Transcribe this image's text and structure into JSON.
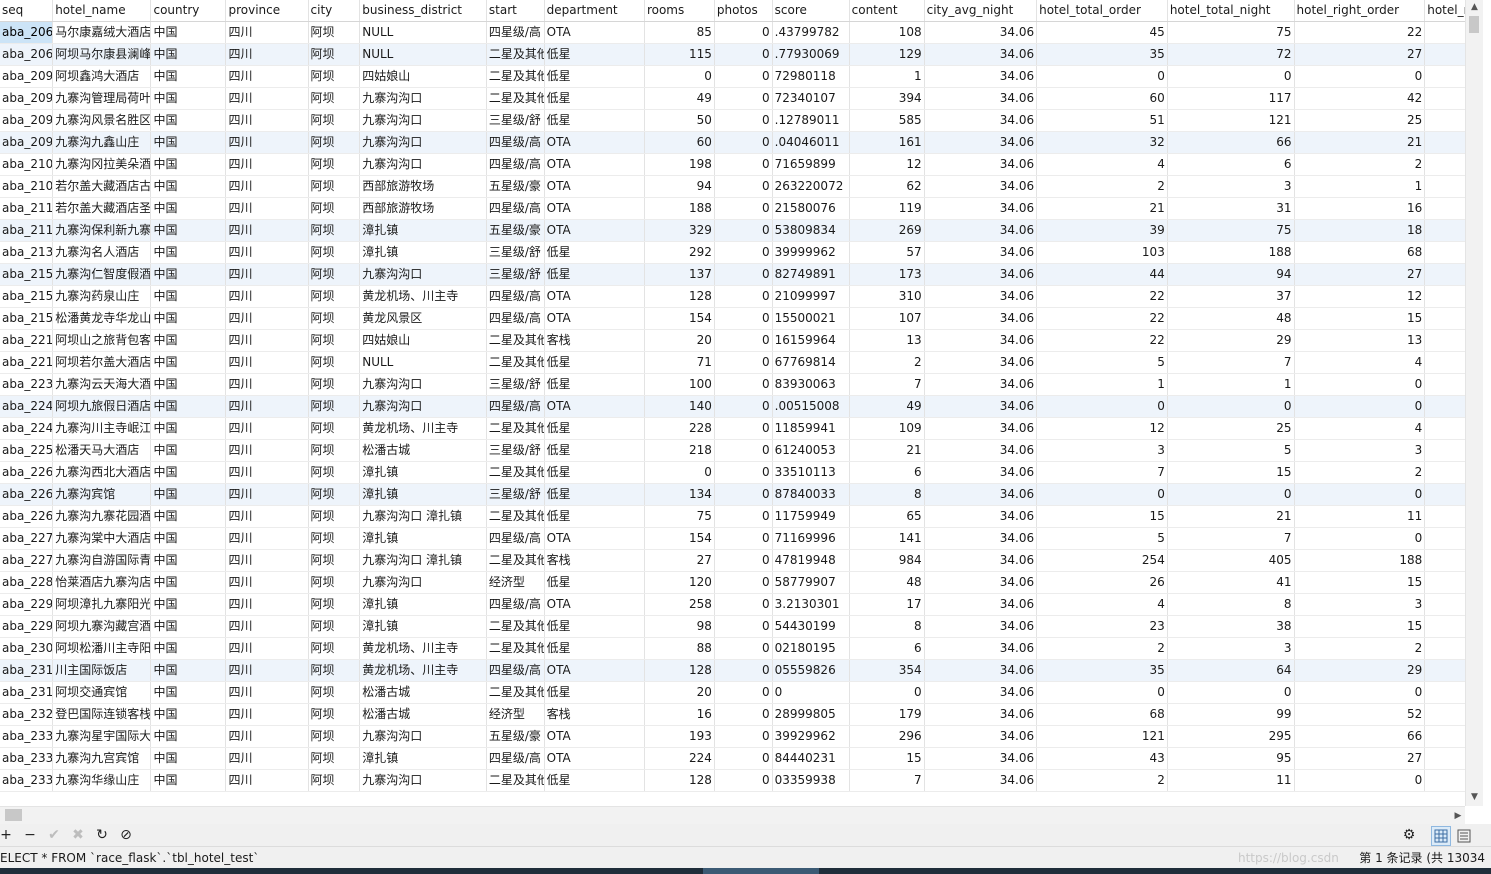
{
  "grid": {
    "columns": [
      "seq",
      "hotel_name",
      "country",
      "province",
      "city",
      "business_district",
      "start",
      "department",
      "rooms",
      "photos",
      "score",
      "content",
      "city_avg_night",
      "hotel_total_order",
      "hotel_total_night",
      "hotel_right_order",
      "hotel_righ"
    ],
    "rows": [
      [
        "aba_206",
        "马尔康嘉绒大酒店",
        "中国",
        "四川",
        "阿坝",
        "NULL",
        "四星级/高",
        "OTA",
        "85",
        "0",
        ".43799782",
        "108",
        "34.06",
        "45",
        "75",
        "22"
      ],
      [
        "aba_206",
        "阿坝马尔康县澜峰",
        "中国",
        "四川",
        "阿坝",
        "NULL",
        "二星及其他",
        "低星",
        "115",
        "0",
        ".77930069",
        "129",
        "34.06",
        "35",
        "72",
        "27"
      ],
      [
        "aba_209",
        "阿坝鑫鸿大酒店",
        "中国",
        "四川",
        "阿坝",
        "四姑娘山",
        "二星及其他",
        "低星",
        "0",
        "0",
        "72980118",
        "1",
        "34.06",
        "0",
        "0",
        "0"
      ],
      [
        "aba_209",
        "九寨沟管理局荷叶",
        "中国",
        "四川",
        "阿坝",
        "九寨沟沟口",
        "二星及其他",
        "低星",
        "49",
        "0",
        "72340107",
        "394",
        "34.06",
        "60",
        "117",
        "42"
      ],
      [
        "aba_209",
        "九寨沟风景名胜区",
        "中国",
        "四川",
        "阿坝",
        "九寨沟沟口",
        "三星级/舒",
        "低星",
        "50",
        "0",
        ".12789011",
        "585",
        "34.06",
        "51",
        "121",
        "25"
      ],
      [
        "aba_209",
        "九寨沟九鑫山庄",
        "中国",
        "四川",
        "阿坝",
        "九寨沟沟口",
        "四星级/高",
        "OTA",
        "60",
        "0",
        ".04046011",
        "161",
        "34.06",
        "32",
        "66",
        "21"
      ],
      [
        "aba_210",
        "九寨沟冈拉美朵酒",
        "中国",
        "四川",
        "阿坝",
        "九寨沟沟口",
        "四星级/高",
        "OTA",
        "198",
        "0",
        "71659899",
        "12",
        "34.06",
        "4",
        "6",
        "2"
      ],
      [
        "aba_210",
        "若尔盖大藏酒店古",
        "中国",
        "四川",
        "阿坝",
        "西部旅游牧场",
        "五星级/豪",
        "OTA",
        "94",
        "0",
        "263220072",
        "62",
        "34.06",
        "2",
        "3",
        "1"
      ],
      [
        "aba_211",
        "若尔盖大藏酒店圣",
        "中国",
        "四川",
        "阿坝",
        "西部旅游牧场",
        "四星级/高",
        "OTA",
        "188",
        "0",
        "21580076",
        "119",
        "34.06",
        "21",
        "31",
        "16"
      ],
      [
        "aba_211",
        "九寨沟保利新九寨",
        "中国",
        "四川",
        "阿坝",
        "漳扎镇",
        "五星级/豪",
        "OTA",
        "329",
        "0",
        "53809834",
        "269",
        "34.06",
        "39",
        "75",
        "18"
      ],
      [
        "aba_213",
        "九寨沟名人酒店",
        "中国",
        "四川",
        "阿坝",
        "漳扎镇",
        "三星级/舒",
        "低星",
        "292",
        "0",
        "39999962",
        "57",
        "34.06",
        "103",
        "188",
        "68"
      ],
      [
        "aba_215",
        "九寨沟仁智度假酒",
        "中国",
        "四川",
        "阿坝",
        "九寨沟沟口",
        "三星级/舒",
        "低星",
        "137",
        "0",
        "82749891",
        "173",
        "34.06",
        "44",
        "94",
        "27"
      ],
      [
        "aba_215",
        "九寨沟药泉山庄",
        "中国",
        "四川",
        "阿坝",
        "黄龙机场、川主寺",
        "四星级/高",
        "OTA",
        "128",
        "0",
        "21099997",
        "310",
        "34.06",
        "22",
        "37",
        "12"
      ],
      [
        "aba_215",
        "松潘黄龙寺华龙山",
        "中国",
        "四川",
        "阿坝",
        "黄龙风景区",
        "四星级/高",
        "OTA",
        "154",
        "0",
        "15500021",
        "107",
        "34.06",
        "22",
        "48",
        "15"
      ],
      [
        "aba_221",
        "阿坝山之旅背包客",
        "中国",
        "四川",
        "阿坝",
        "四姑娘山",
        "二星及其他",
        "客栈",
        "20",
        "0",
        "16159964",
        "13",
        "34.06",
        "22",
        "29",
        "13"
      ],
      [
        "aba_221",
        "阿坝若尔盖大酒店",
        "中国",
        "四川",
        "阿坝",
        "NULL",
        "二星及其他",
        "低星",
        "71",
        "0",
        "67769814",
        "2",
        "34.06",
        "5",
        "7",
        "4"
      ],
      [
        "aba_223",
        "九寨沟云天海大酒",
        "中国",
        "四川",
        "阿坝",
        "九寨沟沟口",
        "三星级/舒",
        "低星",
        "100",
        "0",
        "83930063",
        "7",
        "34.06",
        "1",
        "1",
        "0"
      ],
      [
        "aba_224",
        "阿坝九旅假日酒店",
        "中国",
        "四川",
        "阿坝",
        "九寨沟沟口",
        "四星级/高",
        "OTA",
        "140",
        "0",
        ".00515008",
        "49",
        "34.06",
        "0",
        "0",
        "0"
      ],
      [
        "aba_224",
        "九寨沟川主寺岷江",
        "中国",
        "四川",
        "阿坝",
        "黄龙机场、川主寺",
        "二星及其他",
        "低星",
        "228",
        "0",
        "11859941",
        "109",
        "34.06",
        "12",
        "25",
        "4"
      ],
      [
        "aba_225",
        "松潘天马大酒店",
        "中国",
        "四川",
        "阿坝",
        "松潘古城",
        "三星级/舒",
        "低星",
        "218",
        "0",
        "61240053",
        "21",
        "34.06",
        "3",
        "5",
        "3"
      ],
      [
        "aba_226",
        "九寨沟西北大酒店",
        "中国",
        "四川",
        "阿坝",
        "漳扎镇",
        "二星及其他",
        "低星",
        "0",
        "0",
        "33510113",
        "6",
        "34.06",
        "7",
        "15",
        "2"
      ],
      [
        "aba_226",
        "九寨沟宾馆",
        "中国",
        "四川",
        "阿坝",
        "漳扎镇",
        "三星级/舒",
        "低星",
        "134",
        "0",
        "87840033",
        "8",
        "34.06",
        "0",
        "0",
        "0"
      ],
      [
        "aba_226",
        "九寨沟九寨花园酒",
        "中国",
        "四川",
        "阿坝",
        "九寨沟沟口 漳扎镇",
        "二星及其他",
        "低星",
        "75",
        "0",
        "11759949",
        "65",
        "34.06",
        "15",
        "21",
        "11"
      ],
      [
        "aba_227",
        "九寨沟棠中大酒店",
        "中国",
        "四川",
        "阿坝",
        "漳扎镇",
        "四星级/高",
        "OTA",
        "154",
        "0",
        "71169996",
        "141",
        "34.06",
        "5",
        "7",
        "0"
      ],
      [
        "aba_227",
        "九寨沟自游国际青",
        "中国",
        "四川",
        "阿坝",
        "九寨沟沟口 漳扎镇",
        "二星及其他",
        "客栈",
        "27",
        "0",
        "47819948",
        "984",
        "34.06",
        "254",
        "405",
        "188"
      ],
      [
        "aba_228",
        "怡莱酒店九寨沟店",
        "中国",
        "四川",
        "阿坝",
        "九寨沟沟口",
        "经济型",
        "低星",
        "120",
        "0",
        "58779907",
        "48",
        "34.06",
        "26",
        "41",
        "15"
      ],
      [
        "aba_229",
        "阿坝漳扎九寨阳光",
        "中国",
        "四川",
        "阿坝",
        "漳扎镇",
        "四星级/高",
        "OTA",
        "258",
        "0",
        "3.2130301",
        "17",
        "34.06",
        "4",
        "8",
        "3"
      ],
      [
        "aba_229",
        "阿坝九寨沟藏宫酒",
        "中国",
        "四川",
        "阿坝",
        "漳扎镇",
        "二星及其他",
        "低星",
        "98",
        "0",
        "54430199",
        "8",
        "34.06",
        "23",
        "38",
        "15"
      ],
      [
        "aba_230",
        "阿坝松潘川主寺阳",
        "中国",
        "四川",
        "阿坝",
        "黄龙机场、川主寺",
        "二星及其他",
        "低星",
        "88",
        "0",
        "02180195",
        "6",
        "34.06",
        "2",
        "3",
        "2"
      ],
      [
        "aba_231",
        "川主国际饭店",
        "中国",
        "四川",
        "阿坝",
        "黄龙机场、川主寺",
        "四星级/高",
        "OTA",
        "128",
        "0",
        "05559826",
        "354",
        "34.06",
        "35",
        "64",
        "29"
      ],
      [
        "aba_231",
        "阿坝交通宾馆",
        "中国",
        "四川",
        "阿坝",
        "松潘古城",
        "二星及其他",
        "低星",
        "20",
        "0",
        "0",
        "0",
        "34.06",
        "0",
        "0",
        "0"
      ],
      [
        "aba_232",
        "登巴国际连锁客栈",
        "中国",
        "四川",
        "阿坝",
        "松潘古城",
        "经济型",
        "客栈",
        "16",
        "0",
        "28999805",
        "179",
        "34.06",
        "68",
        "99",
        "52"
      ],
      [
        "aba_233",
        "九寨沟星宇国际大",
        "中国",
        "四川",
        "阿坝",
        "九寨沟沟口",
        "五星级/豪",
        "OTA",
        "193",
        "0",
        "39929962",
        "296",
        "34.06",
        "121",
        "295",
        "66"
      ],
      [
        "aba_233",
        "九寨沟九宫宾馆",
        "中国",
        "四川",
        "阿坝",
        "漳扎镇",
        "四星级/高",
        "OTA",
        "224",
        "0",
        "84440231",
        "15",
        "34.06",
        "43",
        "95",
        "27"
      ],
      [
        "aba_233",
        "九寨沟华缘山庄",
        "中国",
        "四川",
        "阿坝",
        "九寨沟沟口",
        "二星及其他",
        "低星",
        "128",
        "0",
        "03359938",
        "7",
        "34.06",
        "2",
        "11",
        "0"
      ]
    ],
    "highlighted_rows": [
      1,
      5,
      9,
      11,
      17,
      21,
      29
    ]
  },
  "toolbar": {
    "buttons": [
      {
        "name": "add-record-button",
        "glyph": "+",
        "enabled": true
      },
      {
        "name": "delete-record-button",
        "glyph": "−",
        "enabled": true
      },
      {
        "name": "apply-changes-button",
        "glyph": "✔",
        "enabled": false
      },
      {
        "name": "discard-changes-button",
        "glyph": "✖",
        "enabled": false
      },
      {
        "name": "refresh-button",
        "glyph": "↻",
        "enabled": true
      },
      {
        "name": "stop-button",
        "glyph": "⊘",
        "enabled": true
      }
    ]
  },
  "status": {
    "sql": "ELECT * FROM `race_flask`.`tbl_hotel_test`",
    "watermark": "https://blog.csdn",
    "record_info": "第 1 条记录 (共 13034"
  },
  "colors": {
    "selection": "#cce4f7",
    "row_highlight": "#eef4fb"
  }
}
